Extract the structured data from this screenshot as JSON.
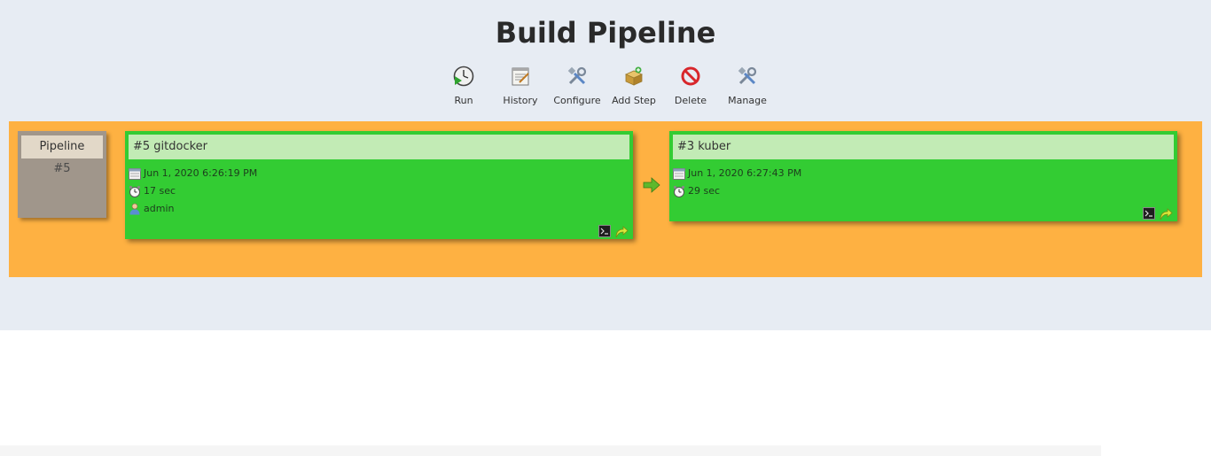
{
  "page": {
    "title": "Build Pipeline"
  },
  "toolbar": {
    "run": {
      "label": "Run",
      "icon": "clock-play-icon"
    },
    "history": {
      "label": "History",
      "icon": "notepad-icon"
    },
    "configure": {
      "label": "Configure",
      "icon": "tools-icon"
    },
    "add_step": {
      "label": "Add Step",
      "icon": "box-icon"
    },
    "delete": {
      "label": "Delete",
      "icon": "no-entry-icon"
    },
    "manage": {
      "label": "Manage",
      "icon": "tools-icon"
    }
  },
  "pipeline": {
    "label": "Pipeline",
    "number": "#5"
  },
  "builds": [
    {
      "title": "#5 gitdocker",
      "date": "Jun 1, 2020 6:26:19 PM",
      "duration": "17 sec",
      "user": "admin",
      "status": "success"
    },
    {
      "title": "#3 kuber",
      "date": "Jun 1, 2020 6:27:43 PM",
      "duration": "29 sec",
      "status": "success"
    }
  ],
  "colors": {
    "header_bg": "#e7ecf3",
    "pipeline_bg": "#feb142",
    "build_success": "#33cc33",
    "build_header": "#c2ebb5",
    "pipeline_box": "#a0968b"
  }
}
